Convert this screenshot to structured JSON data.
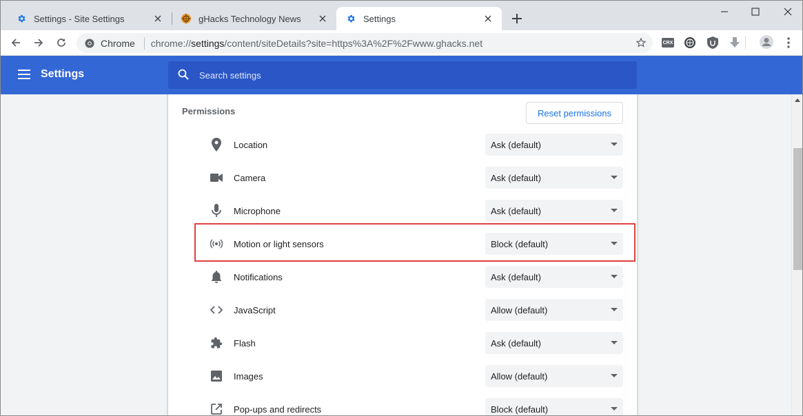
{
  "tabs": [
    {
      "title": "Settings - Site Settings",
      "favicon": "gear-icon"
    },
    {
      "title": "gHacks Technology News",
      "favicon": "ghacks-logo-icon"
    },
    {
      "title": "Settings",
      "favicon": "gear-icon",
      "active": true
    }
  ],
  "toolbar": {
    "scheme_label": "Chrome",
    "url_prefix": "chrome://",
    "url_host": "settings",
    "url_path": "/content/siteDetails?site=https%3A%2F%2Fwww.ghacks.net",
    "extensions": [
      "crx-icon",
      "globe-icon",
      "ublock-icon",
      "download-arrow-icon"
    ],
    "extension_crx_label": "CRX"
  },
  "header": {
    "title": "Settings",
    "search_placeholder": "Search settings",
    "bg_color": "#3367d6"
  },
  "permissions": {
    "section_title": "Permissions",
    "reset_label": "Reset permissions",
    "rows": [
      {
        "label": "Location",
        "value": "Ask (default)",
        "icon": "location-pin-icon"
      },
      {
        "label": "Camera",
        "value": "Ask (default)",
        "icon": "camera-icon"
      },
      {
        "label": "Microphone",
        "value": "Ask (default)",
        "icon": "microphone-icon"
      },
      {
        "label": "Motion or light sensors",
        "value": "Block (default)",
        "icon": "sensors-icon",
        "highlighted": true
      },
      {
        "label": "Notifications",
        "value": "Ask (default)",
        "icon": "bell-icon"
      },
      {
        "label": "JavaScript",
        "value": "Allow (default)",
        "icon": "code-icon"
      },
      {
        "label": "Flash",
        "value": "Ask (default)",
        "icon": "puzzle-icon"
      },
      {
        "label": "Images",
        "value": "Allow (default)",
        "icon": "image-icon"
      },
      {
        "label": "Pop-ups and redirects",
        "value": "Block (default)",
        "icon": "open-in-new-icon"
      }
    ]
  }
}
